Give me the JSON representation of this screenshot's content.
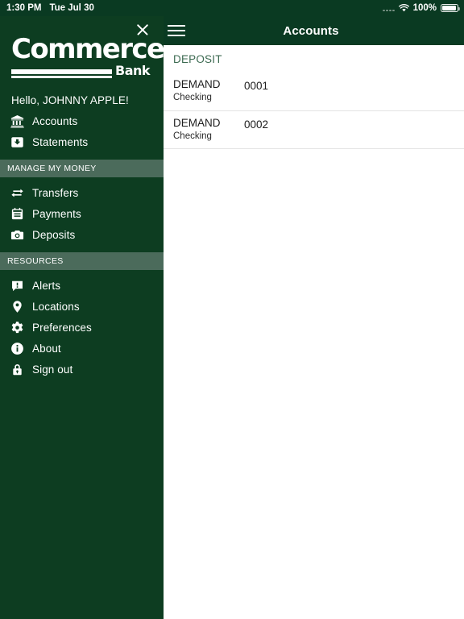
{
  "statusbar": {
    "time": "1:30 PM",
    "date": "Tue Jul 30",
    "battery_percent": "100%",
    "wifi_icon": "wifi-icon",
    "battery_icon": "battery-icon",
    "signal_dots_icon": "signal-dots-icon"
  },
  "header": {
    "title": "Accounts",
    "menu_icon": "hamburger-menu-icon"
  },
  "sidebar": {
    "close_icon": "close-icon",
    "logo": {
      "word": "Commerce",
      "sub": "Bank"
    },
    "greeting": "Hello, JOHNNY APPLE!",
    "items": [
      {
        "label": "Accounts",
        "icon": "bank-building-icon"
      },
      {
        "label": "Statements",
        "icon": "statement-download-icon"
      }
    ],
    "section_manage": "MANAGE MY MONEY",
    "manage_items": [
      {
        "label": "Transfers",
        "icon": "transfer-arrows-icon"
      },
      {
        "label": "Payments",
        "icon": "calendar-payments-icon"
      },
      {
        "label": "Deposits",
        "icon": "camera-icon"
      }
    ],
    "section_resources": "RESOURCES",
    "resource_items": [
      {
        "label": "Alerts",
        "icon": "alert-bubble-icon"
      },
      {
        "label": "Locations",
        "icon": "map-pin-icon"
      },
      {
        "label": "Preferences",
        "icon": "gear-icon"
      },
      {
        "label": "About",
        "icon": "info-circle-icon"
      },
      {
        "label": "Sign out",
        "icon": "lock-icon"
      }
    ]
  },
  "main": {
    "section_title": "DEPOSIT",
    "accounts": [
      {
        "name": "DEMAND",
        "type": "Checking",
        "number": "0001"
      },
      {
        "name": "DEMAND",
        "type": "Checking",
        "number": "0002"
      }
    ]
  },
  "colors": {
    "header_green": "#0a3a22",
    "sidebar_green": "#0d3d21",
    "section_band": "#4b6b5b",
    "accent_text_green": "#3c6a51",
    "divider": "#e3e3e3"
  }
}
